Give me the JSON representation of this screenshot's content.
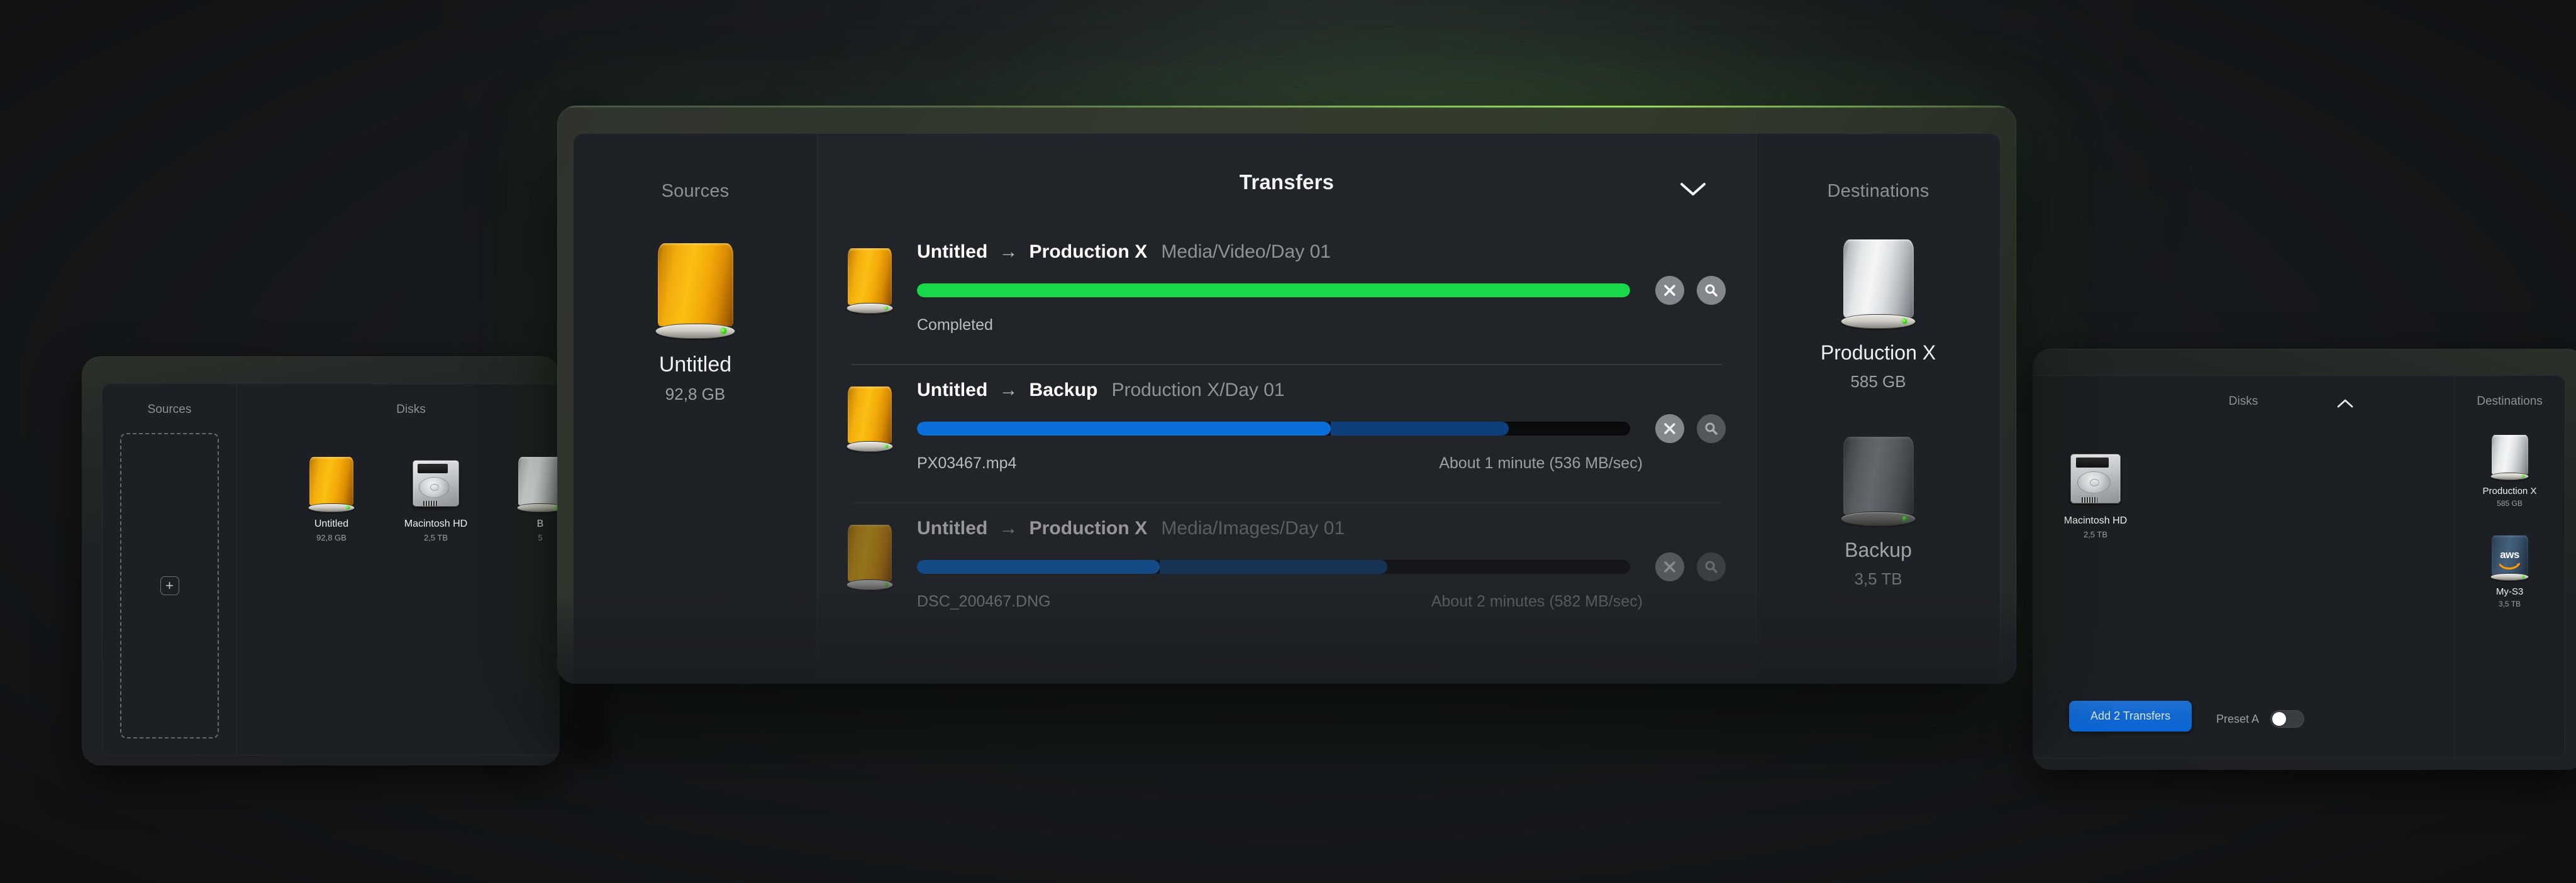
{
  "main_window": {
    "center_title": "Transfers",
    "collapse_icon": "chevron-down-icon",
    "sources": {
      "title": "Sources",
      "items": [
        {
          "name": "Untitled",
          "size": "92,8 GB",
          "icon": "external-drive-orange-icon",
          "faded": false
        }
      ]
    },
    "destinations": {
      "title": "Destinations",
      "items": [
        {
          "name": "Production X",
          "size": "585 GB",
          "icon": "external-drive-silver-icon",
          "faded": false
        },
        {
          "name": "Backup",
          "size": "3,5 TB",
          "icon": "external-drive-dark-icon",
          "faded": true
        }
      ]
    },
    "transfers": [
      {
        "source": "Untitled",
        "arrow": "→",
        "destination": "Production X",
        "path": "Media/Video/Day 01",
        "status_left": "Completed",
        "status_right": "",
        "progress_percent": 100,
        "buffer_percent": 100,
        "bar_color": "#17d94a",
        "buffer_color": "#17d94a",
        "state": "completed",
        "cancel_icon": "close-icon",
        "reveal_icon": "search-icon",
        "reveal_enabled": true,
        "faded": false
      },
      {
        "source": "Untitled",
        "arrow": "→",
        "destination": "Backup",
        "path": "Production X/Day 01",
        "status_left": "PX03467.mp4",
        "status_right": "About 1 minute (536 MB/sec)",
        "progress_percent": 58,
        "buffer_percent": 83,
        "bar_color": "#0a6fdb",
        "buffer_color": "#0d3f7d",
        "state": "in-progress",
        "cancel_icon": "close-icon",
        "reveal_icon": "search-icon",
        "reveal_enabled": false,
        "faded": false
      },
      {
        "source": "Untitled",
        "arrow": "→",
        "destination": "Production X",
        "path": "Media/Images/Day 01",
        "status_left": "DSC_200467.DNG",
        "status_right": "About 2 minutes (582 MB/sec)",
        "progress_percent": 34,
        "buffer_percent": 66,
        "bar_color": "#0a6fdb",
        "buffer_color": "#0d3f7d",
        "state": "in-progress",
        "cancel_icon": "close-icon",
        "reveal_icon": "search-icon",
        "reveal_enabled": false,
        "faded": true
      }
    ]
  },
  "left_window": {
    "sources": {
      "title": "Sources",
      "dropzone_add_label": "+"
    },
    "disks": {
      "title": "Disks",
      "items": [
        {
          "name": "Untitled",
          "size": "92,8 GB",
          "icon": "external-drive-orange-icon"
        },
        {
          "name": "Macintosh HD",
          "size": "2,5 TB",
          "icon": "internal-hard-disk-icon"
        },
        {
          "name": "B",
          "size": "5",
          "icon": "external-drive-silver-icon"
        }
      ]
    }
  },
  "right_window": {
    "disks": {
      "title": "Disks",
      "collapse_icon": "chevron-up-icon",
      "items": [
        {
          "name": "Macintosh HD",
          "size": "2,5 TB",
          "icon": "internal-hard-disk-icon"
        }
      ]
    },
    "destinations": {
      "title": "Destinations",
      "items": [
        {
          "name": "Production X",
          "size": "585 GB",
          "icon": "external-drive-silver-icon"
        },
        {
          "name": "My-S3",
          "size": "3,5 TB",
          "icon": "aws-s3-drive-icon",
          "badge": "aws"
        }
      ]
    },
    "footer": {
      "add_transfers_label": "Add 2 Transfers",
      "preset_label": "Preset A",
      "preset_enabled": false
    }
  },
  "theme": {
    "background": "#1b1e22",
    "panel": "#212429",
    "sidebar": "#1e2125",
    "accent_green": "#17d94a",
    "accent_blue": "#0a6fdb",
    "rim_green": "#a8eb69",
    "text_primary": "#ffffff",
    "text_secondary": "#9aa0a6"
  }
}
